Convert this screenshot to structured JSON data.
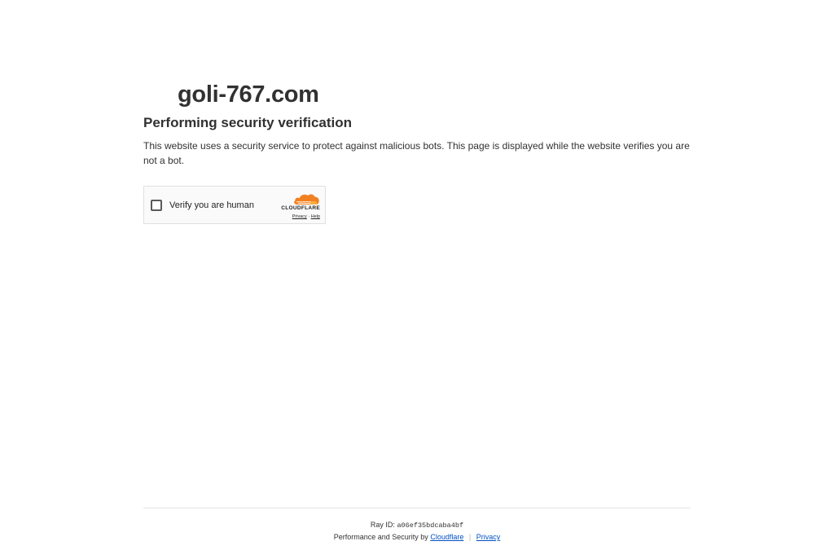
{
  "site": {
    "domain": "goli-767.com"
  },
  "challenge": {
    "heading": "Performing security verification",
    "description": "This website uses a security service to protect against malicious bots. This page is displayed while the website verifies you are not a bot."
  },
  "widget": {
    "checkbox_label": "Verify you are human",
    "brand_wordmark": "CLOUDFLARE",
    "privacy_link": "Privacy",
    "link_separator": "·",
    "help_link": "Help",
    "brand_icon": "cloudflare-cloud-icon",
    "brand_color": "#f38020"
  },
  "footer": {
    "ray_label": "Ray ID:",
    "ray_id": "a06ef35bdcaba4bf",
    "perf_text": "Performance and Security by",
    "cloudflare_link": "Cloudflare",
    "separator": "|",
    "privacy_link": "Privacy",
    "link_color": "#0051c3"
  }
}
